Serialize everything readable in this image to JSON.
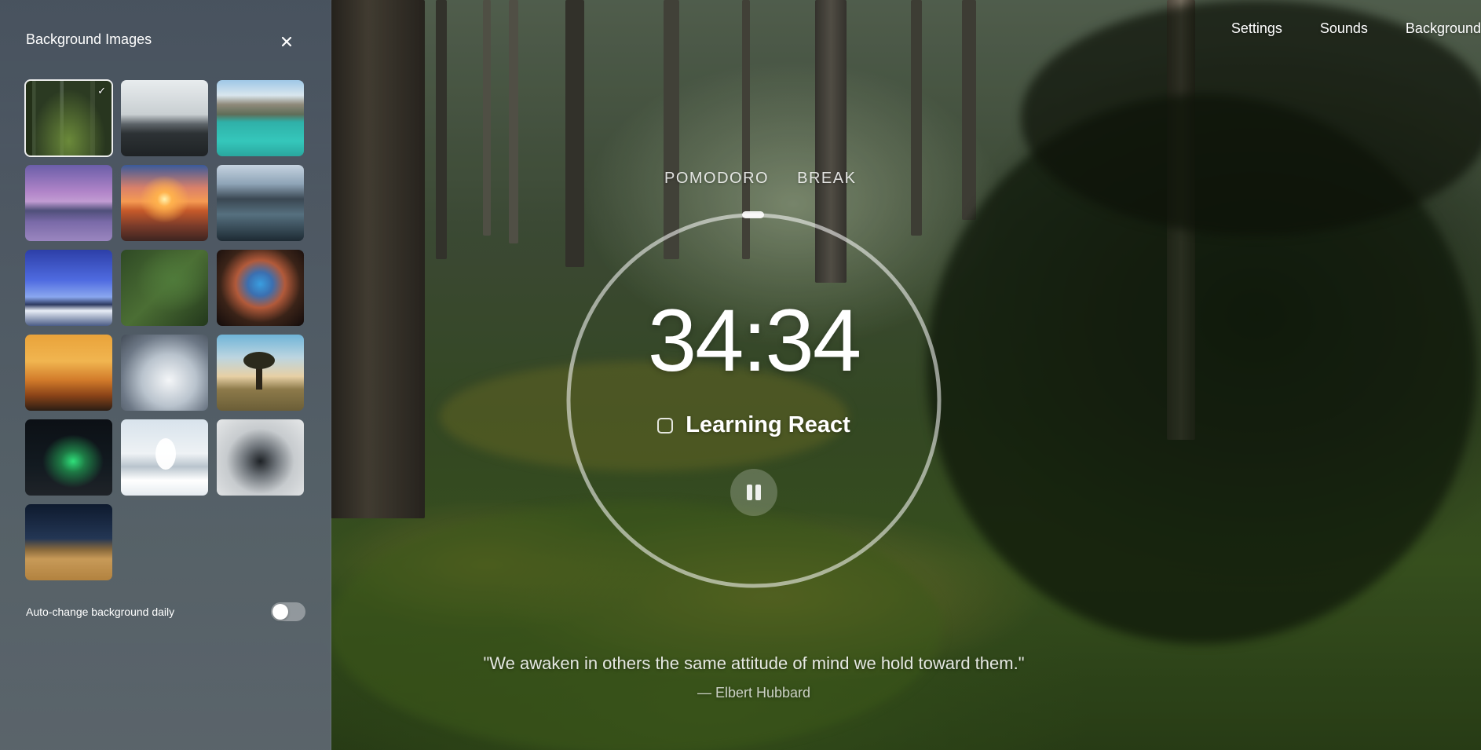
{
  "nav": {
    "settings": "Settings",
    "sounds": "Sounds",
    "background": "Background"
  },
  "panel": {
    "title": "Background Images",
    "close_icon": "close-icon",
    "selected_check": "✓",
    "auto_change_label": "Auto-change background daily",
    "auto_change_enabled": false
  },
  "thumbnails": [
    {
      "name": "forest",
      "selected": true
    },
    {
      "name": "misty-pines",
      "selected": false
    },
    {
      "name": "mountain-lake",
      "selected": false
    },
    {
      "name": "purple-lake-tree",
      "selected": false
    },
    {
      "name": "ocean-sunset",
      "selected": false
    },
    {
      "name": "fjord-valley",
      "selected": false
    },
    {
      "name": "blue-sea-of-clouds",
      "selected": false
    },
    {
      "name": "aerial-forest-road",
      "selected": false
    },
    {
      "name": "nebula",
      "selected": false
    },
    {
      "name": "golden-hills",
      "selected": false
    },
    {
      "name": "snowy-peak",
      "selected": false
    },
    {
      "name": "lone-tree-field",
      "selected": false
    },
    {
      "name": "aurora-night",
      "selected": false
    },
    {
      "name": "winter-tree",
      "selected": false
    },
    {
      "name": "cloud-mountains",
      "selected": false
    },
    {
      "name": "desert-night-sky",
      "selected": false
    }
  ],
  "timer": {
    "modes": [
      "POMODORO",
      "BREAK"
    ],
    "time": "34:34",
    "task": "Learning React",
    "task_done": false,
    "pause_icon": "pause-icon"
  },
  "quote": {
    "text": "\"We awaken in others the same attitude of mind we hold toward them.\"",
    "author": "— Elbert Hubbard"
  }
}
